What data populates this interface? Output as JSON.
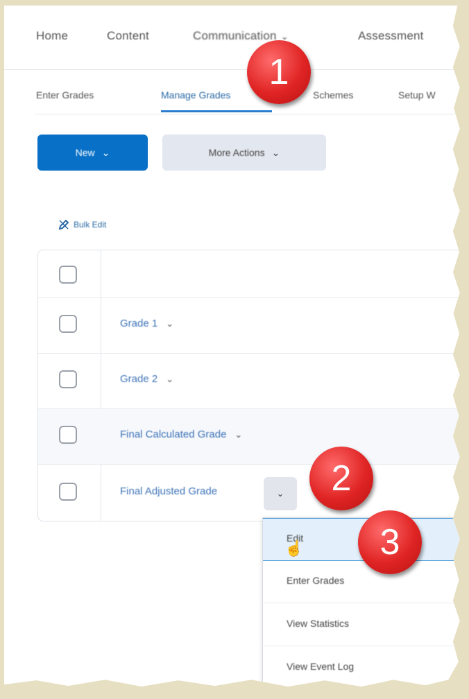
{
  "nav": {
    "items": [
      "Home",
      "Content",
      "Communication",
      "Assessment"
    ]
  },
  "subtabs": [
    "Enter Grades",
    "Manage Grades",
    "Schemes",
    "Setup W"
  ],
  "toolbar": {
    "new_label": "New",
    "more_actions_label": "More Actions",
    "bulk_edit_label": "Bulk Edit"
  },
  "grades": {
    "rows": [
      "Grade 1",
      "Grade 2",
      "Final Calculated Grade",
      "Final Adjusted Grade"
    ]
  },
  "menu": {
    "items": [
      "Edit",
      "Enter Grades",
      "View Statistics",
      "View Event Log"
    ]
  },
  "badges": [
    "1",
    "2",
    "3"
  ],
  "colors": {
    "primary": "#0870c6",
    "link": "#3f74b8",
    "badge": "#e02424",
    "frame": "#e6dfc1"
  }
}
